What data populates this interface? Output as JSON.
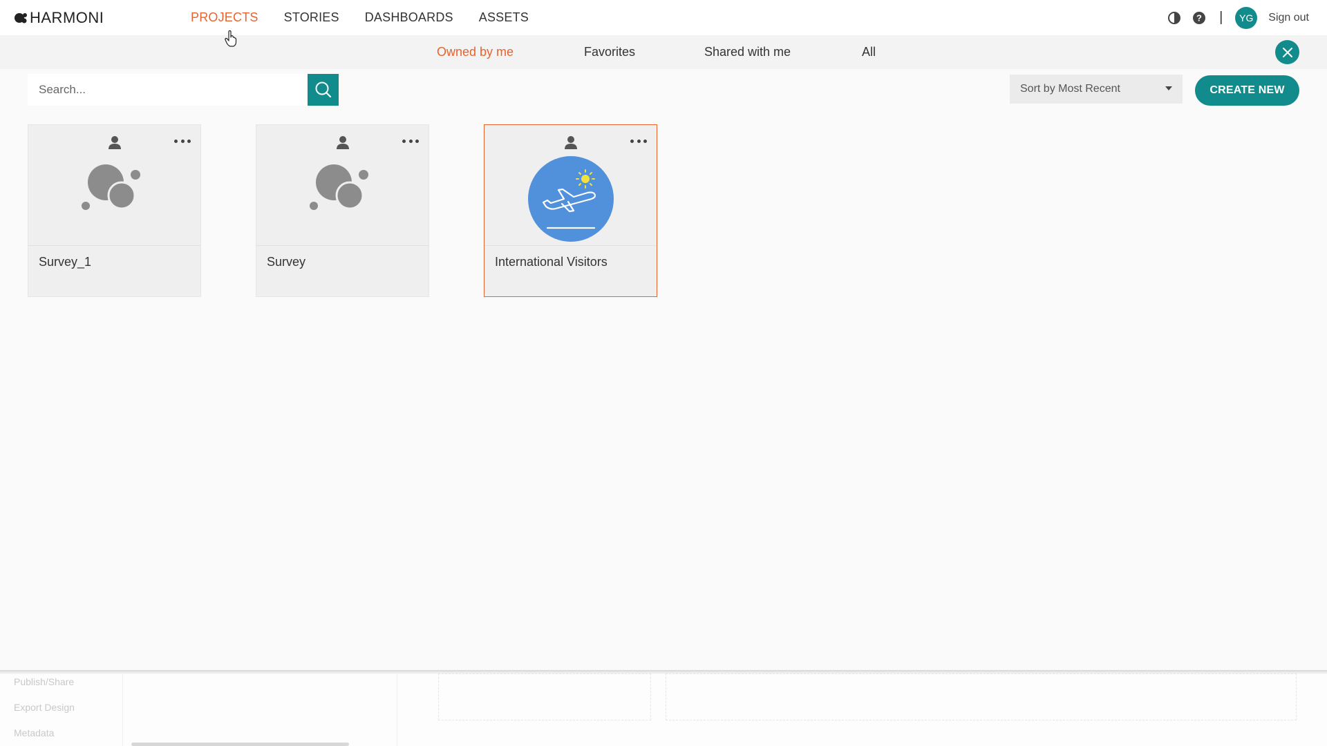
{
  "app": {
    "logo": "HARMONI"
  },
  "nav": [
    {
      "label": "PROJECTS",
      "active": true
    },
    {
      "label": "STORIES",
      "active": false
    },
    {
      "label": "DASHBOARDS",
      "active": false
    },
    {
      "label": "ASSETS",
      "active": false
    }
  ],
  "user": {
    "initials": "YG",
    "signout": "Sign out"
  },
  "subtabs": [
    {
      "label": "Owned by me",
      "active": true
    },
    {
      "label": "Favorites",
      "active": false
    },
    {
      "label": "Shared with me",
      "active": false
    },
    {
      "label": "All",
      "active": false
    }
  ],
  "search": {
    "placeholder": "Search..."
  },
  "sort": {
    "value": "Sort by Most Recent"
  },
  "create": {
    "label": "CREATE NEW"
  },
  "projects": [
    {
      "title": "Survey_1",
      "thumbnail": "bubbles-icon"
    },
    {
      "title": "Survey",
      "thumbnail": "bubbles-icon"
    },
    {
      "title": "International Visitors",
      "thumbnail": "airplane-icon",
      "selected": true
    }
  ],
  "lower_menu": [
    "Publish/Share",
    "Export Design",
    "Metadata"
  ],
  "colors": {
    "accent": "#e8622c",
    "teal": "#128b8c"
  }
}
